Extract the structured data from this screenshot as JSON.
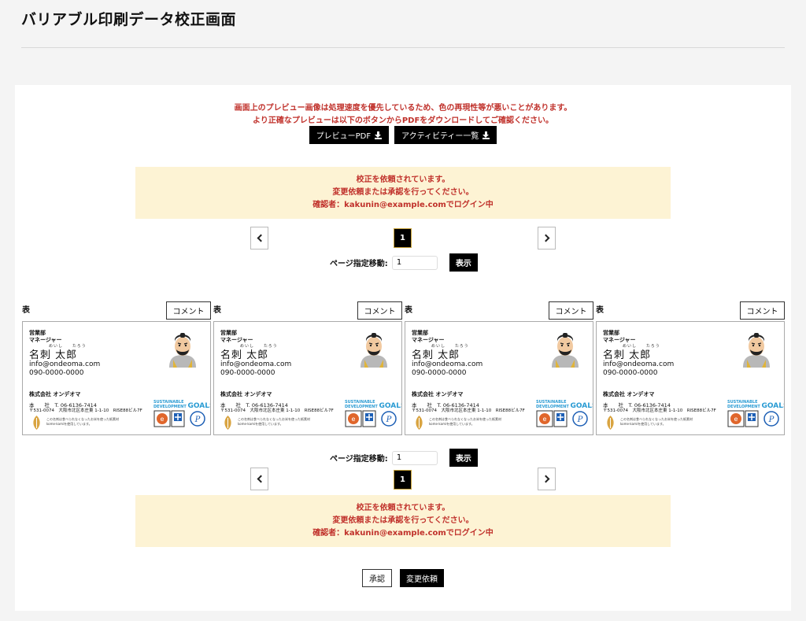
{
  "page": {
    "title": "バリアブル印刷データ校正画面"
  },
  "notice": {
    "line1": "画面上のプレビュー画像は処理速度を優先しているため、色の再現性等が悪いことがあります。",
    "line2": "より正確なプレビューは以下のボタンからPDFをダウンロードしてご確認ください。"
  },
  "downloads": {
    "preview_pdf": "プレビューPDF",
    "activity_list": "アクティビティー一覧"
  },
  "alert": {
    "line1": "校正を依頼されています。",
    "line2": "変更依頼または承認を行ってください。",
    "line3": "確認者：kakunin@example.comでログイン中"
  },
  "pagination": {
    "current": "1",
    "jump_label": "ページ指定移動:",
    "jump_value": "1",
    "show_label": "表示"
  },
  "cards": [
    {
      "side": "表",
      "comment_label": "コメント"
    },
    {
      "side": "表",
      "comment_label": "コメント"
    },
    {
      "side": "表",
      "comment_label": "コメント"
    },
    {
      "side": "表",
      "comment_label": "コメント"
    }
  ],
  "business_card": {
    "dept": "営業部",
    "role": "マネージャー",
    "ruby": "めいし　　たろう",
    "name": "名刺 太郎",
    "email": "info@ondeoma.com",
    "phone": "090-0000-0000",
    "company": "株式会社 オンデオマ",
    "address1": "本　　社　T. 06-6136-7414",
    "address2": "〒531-0074　大阪市北区本庄東 1-1-10　RISE88ビル7F",
    "paper_note1": "この名刺は食べられなくなったお米を使った紙素材",
    "paper_note2": "kome-kamiを使用しています。",
    "sdg_line1": "SUSTAINABLE",
    "sdg_line2": "DEVELOPMENT",
    "sdg_goals": "GOALS"
  },
  "actions": {
    "approve": "承認",
    "request_change": "変更依頼"
  }
}
